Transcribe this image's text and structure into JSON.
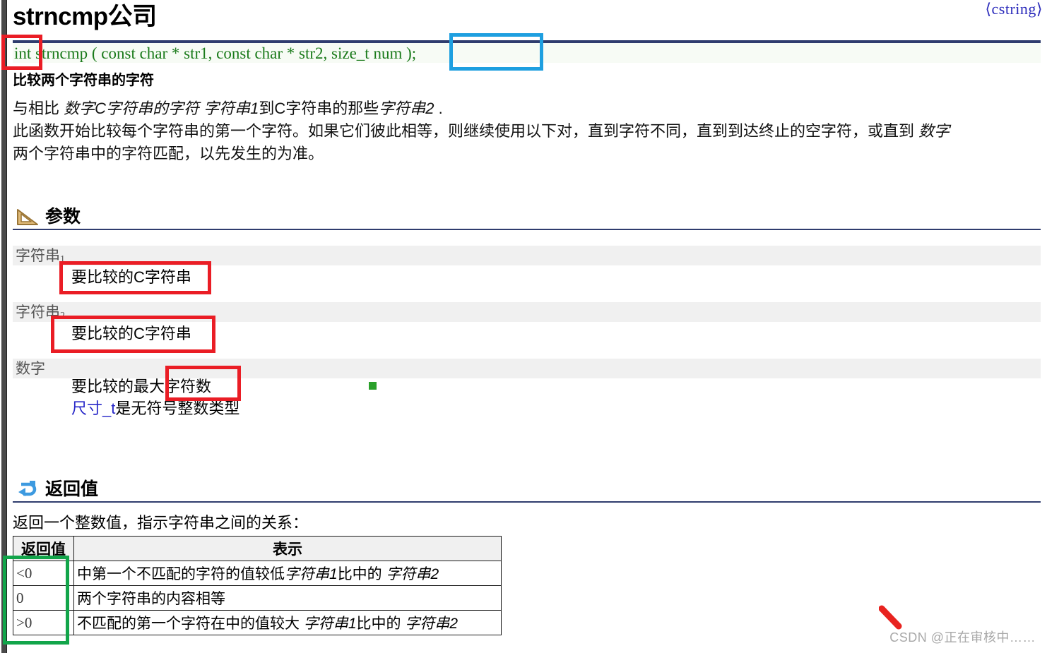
{
  "header": {
    "title": "strncmp公司",
    "include": "⟨cstring⟩"
  },
  "prototype": {
    "return_type": "int",
    "rest": "strncmp ( const char * str1, const char * str2, ",
    "size_param": "size_t num",
    "tail": " );"
  },
  "description": {
    "title": "比较两个字符串的字符",
    "line1_a": "与相比 ",
    "line1_b": "数字C字符串的字符 ",
    "line1_c": "字符串1",
    "line1_d": "到C字符串的那些",
    "line1_e": "字符串2",
    "line1_f": " .",
    "line2_a": "此函数开始比较每个字符串的第一个字符。如果它们彼此相等，则继续使用以下对，直到字符不同，直到到达终止的空字符，或直到 ",
    "line2_b": "数字",
    "line3": "两个字符串中的字符匹配，以先发生的为准。"
  },
  "sections": {
    "parameters": {
      "label": "参数",
      "icon": "ruler-triangle-icon"
    },
    "return_value": {
      "label": "返回值",
      "icon": "return-arrow-icon"
    }
  },
  "parameters": [
    {
      "name_main": "字符串",
      "name_sub": "1",
      "desc": "要比较的C字符串"
    },
    {
      "name_main": "字符串",
      "name_sub": "2",
      "desc": "要比较的C字符串"
    },
    {
      "name_main": "数字",
      "name_sub": "",
      "desc": "要比较的最大字符数",
      "desc2_link": "尺寸_t",
      "desc2_rest": "是无符号整数类型"
    }
  ],
  "return_value": {
    "intro": "返回一个整数值，指示字符串之间的关系：",
    "table": {
      "headers": [
        "返回值",
        "表示"
      ],
      "rows": [
        {
          "code": "<0",
          "text_a": "中第一个不匹配的字符的值较低",
          "text_b": "字符串1",
          "text_c": "比中的 ",
          "text_d": "字符串2"
        },
        {
          "code": "0",
          "text_a": "两个字符串的内容相等",
          "text_b": "",
          "text_c": "",
          "text_d": ""
        },
        {
          "code": ">0",
          "text_a": "不匹配的第一个字符在中的值较大 ",
          "text_b": "字符串1",
          "text_c": "比中的 ",
          "text_d": "字符串2"
        }
      ]
    }
  },
  "annotations": [
    {
      "name": "int-highlight",
      "color": "#ea1d25"
    },
    {
      "name": "size-param-highlight",
      "color": "#1e9fe0"
    },
    {
      "name": "str1-desc-highlight",
      "color": "#ea1d25"
    },
    {
      "name": "str2-desc-highlight",
      "color": "#ea1d25"
    },
    {
      "name": "num-desc-highlight",
      "color": "#ea1d25"
    },
    {
      "name": "return-col-highlight",
      "color": "#12a54a"
    }
  ],
  "watermark": {
    "text": "CSDN @正在审核中……"
  }
}
